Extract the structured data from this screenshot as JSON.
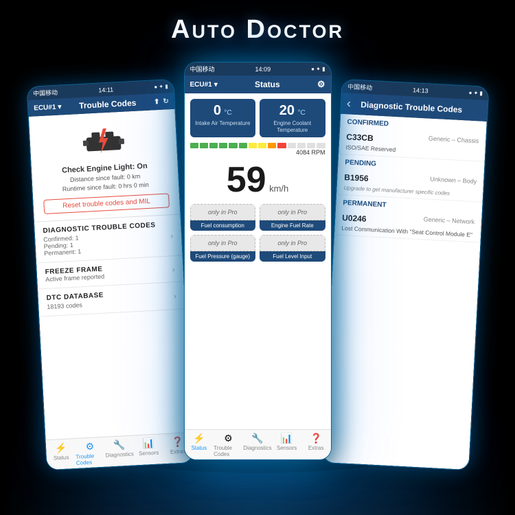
{
  "app": {
    "title": "Auto Doctor"
  },
  "left_phone": {
    "status_bar": {
      "carrier": "中国移动",
      "time": "14:11",
      "icons": "● ✦ ▶ ■"
    },
    "nav": {
      "ecu": "ECU#1",
      "title": "Trouble Codes",
      "dropdown": "▾"
    },
    "engine": {
      "check_engine_label": "Check Engine Light: On",
      "distance": "Distance since fault: 0 km",
      "runtime": "Runtime since fault: 0 hrs 0 min",
      "reset_btn": "Reset trouble codes and MIL"
    },
    "menu": [
      {
        "title": "DIAGNOSTIC TROUBLE CODES",
        "sub": "Confirmed: 1\nPending: 1\nPermanent: 1"
      },
      {
        "title": "FREEZE FRAME",
        "sub": "Active frame reported"
      },
      {
        "title": "DTC DATABASE",
        "sub": "18193 codes"
      }
    ],
    "tabs": [
      {
        "icon": "⚡",
        "label": "Status",
        "active": false
      },
      {
        "icon": "⚙",
        "label": "Trouble Codes",
        "active": true
      },
      {
        "icon": "🔧",
        "label": "Diagnostics",
        "active": false
      },
      {
        "icon": "📊",
        "label": "Sensors",
        "active": false
      },
      {
        "icon": "❓",
        "label": "Extras",
        "active": false
      }
    ]
  },
  "center_phone": {
    "status_bar": {
      "carrier": "中国移动",
      "time": "14:09",
      "icons": "● ✦ ▶ ■"
    },
    "nav": {
      "ecu": "ECU#1",
      "title": "Status",
      "dropdown": "▾",
      "settings_icon": "⚙"
    },
    "sensor1": {
      "value": "0",
      "unit": "°C",
      "label": "Intake Air Temperature"
    },
    "sensor2": {
      "value": "20",
      "unit": "°C",
      "label": "Engine Coolant Temperature"
    },
    "rpm": {
      "value": "4084",
      "unit": "RPM"
    },
    "speed": {
      "value": "59",
      "unit": "km/h"
    },
    "pro_rows": [
      {
        "items": [
          {
            "badge": "only in Pro",
            "label": "Fuel consumption"
          },
          {
            "badge": "only in Pro",
            "label": "Engine Fuel Rate"
          }
        ]
      },
      {
        "items": [
          {
            "badge": "only in Pro",
            "label": "Fuel Pressure (gauge)"
          },
          {
            "badge": "only in Pro",
            "label": "Fuel Level Input"
          }
        ]
      }
    ],
    "tabs": [
      {
        "icon": "⚡",
        "label": "Status",
        "active": true
      },
      {
        "icon": "⚙",
        "label": "Trouble Codes",
        "active": false
      },
      {
        "icon": "🔧",
        "label": "Diagnostics",
        "active": false
      },
      {
        "icon": "📊",
        "label": "Sensors",
        "active": false
      },
      {
        "icon": "❓",
        "label": "Extras",
        "active": false
      }
    ]
  },
  "right_phone": {
    "status_bar": {
      "carrier": "中国移动",
      "time": "14:13",
      "icons": "● ✦ ▶ ■"
    },
    "nav": {
      "back": "‹",
      "title": "Diagnostic Trouble Codes"
    },
    "sections": [
      {
        "header": "Confirmed",
        "items": [
          {
            "code": "C33CB",
            "type": "Generic – Chassis",
            "desc": "ISO/SAE Reserved",
            "upgrade": ""
          }
        ]
      },
      {
        "header": "Pending",
        "items": [
          {
            "code": "B1956",
            "type": "Unknown – Body",
            "desc": "Upgrade to get manufacturer specific codes",
            "upgrade": ""
          }
        ]
      },
      {
        "header": "Permanent",
        "items": [
          {
            "code": "U0246",
            "type": "Generic – Network",
            "desc": "Lost Communication With \"Seat Control Module E\"",
            "upgrade": ""
          }
        ]
      }
    ]
  }
}
